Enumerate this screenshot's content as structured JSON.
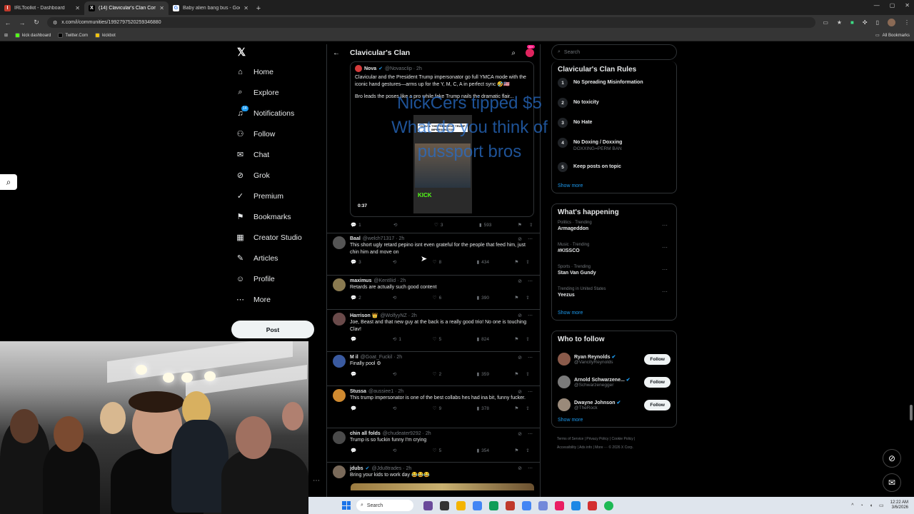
{
  "browser": {
    "tabs": [
      {
        "title": "IRLToolkit - Dashboard",
        "active": false,
        "icon_color": "#c0392b",
        "icon": "I"
      },
      {
        "title": "(14) Clavicular's Clan Commun",
        "active": true,
        "icon_color": "#000000",
        "icon": "X"
      },
      {
        "title": "Baby alien bang bus - Google S",
        "active": false,
        "icon_color": "#ffffff",
        "icon": "G"
      }
    ],
    "new_tab": "+",
    "url": "x.com/i/communities/1992797520259346880",
    "bookmarks": [
      {
        "label": "kick dashboard",
        "color": "#53fc18"
      },
      {
        "label": "Twitter.Com",
        "color": "#000000"
      },
      {
        "label": "kickbot",
        "color": "#f1c40f"
      }
    ],
    "all_bookmarks": "All Bookmarks"
  },
  "x_logo": "𝕏",
  "nav": {
    "items": [
      {
        "label": "Home",
        "icon": "⌂",
        "name": "home"
      },
      {
        "label": "Explore",
        "icon": "⌕",
        "name": "explore"
      },
      {
        "label": "Notifications",
        "icon": "♫",
        "name": "notifications",
        "badge": "14"
      },
      {
        "label": "Follow",
        "icon": "⚇",
        "name": "follow"
      },
      {
        "label": "Chat",
        "icon": "✉",
        "name": "chat"
      },
      {
        "label": "Grok",
        "icon": "⊘",
        "name": "grok"
      },
      {
        "label": "Premium",
        "icon": "✓",
        "name": "premium"
      },
      {
        "label": "Bookmarks",
        "icon": "⚑",
        "name": "bookmarks"
      },
      {
        "label": "Creator Studio",
        "icon": "▦",
        "name": "creator-studio"
      },
      {
        "label": "Articles",
        "icon": "✎",
        "name": "articles"
      },
      {
        "label": "Profile",
        "icon": "☺",
        "name": "profile"
      },
      {
        "label": "More",
        "icon": "⋯",
        "name": "more"
      }
    ],
    "post_label": "Post"
  },
  "community": {
    "title": "Clavicular's Clan",
    "badge": "20+"
  },
  "quoted": {
    "name": "Nova",
    "handle": "@NovascIip · 2h",
    "text1": "Clavicular and the President Trump impersonator go full YMCA mode with the iconic hand gestures—arms up for the Y, M, C, A in perfect sync 🤣🇺🇸",
    "text2": "Bro leads the poses like a pro while fake Trump nails the dramatic flair...",
    "video_caption": "CLAV & THE PRESIDENT TRUMP IMPERSONATOR",
    "video_brand": "KICK",
    "video_time": "0:37",
    "stats": {
      "reply": "1",
      "repost": "",
      "like": "3",
      "views": "593"
    }
  },
  "tip_overlay": {
    "line1": "NickCers tipped $5",
    "line2": "What do you think of",
    "line3": "pussport bros"
  },
  "tweets": [
    {
      "name": "Baal",
      "handle": "@welch71317 · 2h",
      "text": "This short ugly retard pepino isnt even grateful for the people that feed him, just chin him and move on",
      "reply": "3",
      "repost": "",
      "like": "8",
      "views": "434",
      "avatar": "#555"
    },
    {
      "name": "maximus",
      "handle": "@Kent8id · 2h",
      "text": "Retards are actually such good content",
      "reply": "2",
      "repost": "",
      "like": "6",
      "views": "390",
      "avatar": "#8a7a50"
    },
    {
      "name": "Harrison 👑",
      "handle": "@WolfyyNZ · 2h",
      "text": "Joe, Beast and that new guy at the back is a really good trio! No one is touching Clav!",
      "reply": "",
      "repost": "1",
      "like": "5",
      "views": "824",
      "avatar": "#6a4a4a"
    },
    {
      "name": "M il",
      "handle": "@Goat_Fuckil · 2h",
      "text": "Finally pool ⚙",
      "reply": "",
      "repost": "",
      "like": "2",
      "views": "359",
      "avatar": "#3a5aa0"
    },
    {
      "name": "Stussa",
      "handle": "@aussiee1 · 2h",
      "text": "This trump impersonator is one of the best collabs hes had ina bit, funny fucker.",
      "reply": "",
      "repost": "",
      "like": "9",
      "views": "378",
      "avatar": "#d08a30"
    },
    {
      "name": "chin all folds",
      "handle": "@chudeater9292 · 2h",
      "text": "Trump is so fuckin funny I'm crying",
      "reply": "",
      "repost": "",
      "like": "5",
      "views": "354",
      "avatar": "#4a4a4a"
    },
    {
      "name": "jdubs",
      "handle": "@Jdu8trades · 2h",
      "text": "Bring your kids to work day 😂😂😂",
      "reply": "",
      "repost": "",
      "like": "",
      "views": "",
      "avatar": "#7a6a5a"
    }
  ],
  "right": {
    "search_placeholder": "Search",
    "rules_title": "Clavicular's Clan Rules",
    "rules": [
      {
        "num": "1",
        "text": "No Spreading Misinformation",
        "sub": ""
      },
      {
        "num": "2",
        "text": "No toxicity",
        "sub": ""
      },
      {
        "num": "3",
        "text": "No Hate",
        "sub": ""
      },
      {
        "num": "4",
        "text": "No Doxing / Doxxing",
        "sub": "DOXXING=PERM BAN"
      },
      {
        "num": "5",
        "text": "Keep posts on topic",
        "sub": ""
      }
    ],
    "show_more": "Show more",
    "happening_title": "What's happening",
    "trends": [
      {
        "context": "Politics · Trending",
        "name": "Armageddon"
      },
      {
        "context": "Music · Trending",
        "name": "#KISSCO"
      },
      {
        "context": "Sports · Trending",
        "name": "Stan Van Gundy"
      },
      {
        "context": "Trending in United States",
        "name": "Yeezus"
      }
    ],
    "who_title": "Who to follow",
    "who": [
      {
        "name": "Ryan Reynolds",
        "handle": "@VancityReynolds",
        "avatar": "#8a5a4a"
      },
      {
        "name": "Arnold Schwarzene...",
        "handle": "@Schwarzenegger",
        "avatar": "#7a7a7a"
      },
      {
        "name": "Dwayne Johnson",
        "handle": "@TheRock",
        "avatar": "#9a8a7a"
      }
    ],
    "follow_label": "Follow",
    "footer1": "Terms of Service  |  Privacy Policy  |  Cookie Policy  |",
    "footer2": "Accessibility  |  Ads info  |  More ···  © 2026 X Corp."
  },
  "taskbar": {
    "search": "Search",
    "time": "12:22 AM",
    "date": "3/6/2026"
  }
}
